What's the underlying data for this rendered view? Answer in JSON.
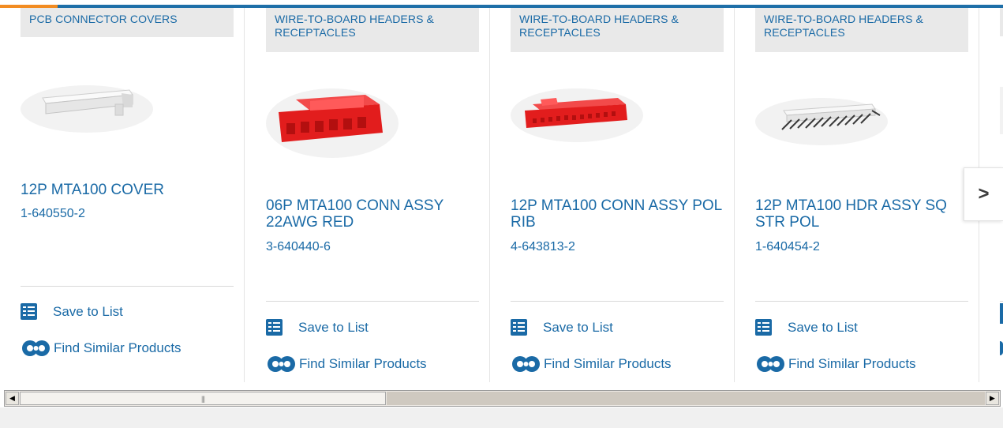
{
  "colors": {
    "link": "#1a6aa6",
    "accent_orange": "#f28c22",
    "accent_blue": "#1e6fa8",
    "category_bg": "#e9e9e9"
  },
  "cards": [
    {
      "category": "PCB CONNECTOR COVERS",
      "name": "12P MTA100 COVER",
      "part_number": "1-640550-2",
      "save_label": "Save to List",
      "similar_label": "Find Similar Products",
      "image": "white-connector-cover-image"
    },
    {
      "category": "WIRE-TO-BOARD HEADERS & RECEPTACLES",
      "name": "06P MTA100 CONN ASSY 22AWG RED",
      "part_number": "3-640440-6",
      "save_label": "Save to List",
      "similar_label": "Find Similar Products",
      "image": "red-6-position-connector-image"
    },
    {
      "category": "WIRE-TO-BOARD HEADERS & RECEPTACLES",
      "name": "12P MTA100 CONN ASSY POL RIB",
      "part_number": "4-643813-2",
      "save_label": "Save to List",
      "similar_label": "Find Similar Products",
      "image": "red-12-position-connector-image"
    },
    {
      "category": "WIRE-TO-BOARD HEADERS & RECEPTACLES",
      "name": "12P MTA100 HDR ASSY SQ STR POL",
      "part_number": "1-640454-2",
      "save_label": "Save to List",
      "similar_label": "Find Similar Products",
      "image": "white-header-with-pins-image"
    }
  ],
  "carousel": {
    "next_icon": "chevron-right-icon",
    "next_glyph": ">"
  },
  "scrollbar": {
    "left_arrow": "◀",
    "right_arrow": "▶",
    "grip": "|||"
  }
}
